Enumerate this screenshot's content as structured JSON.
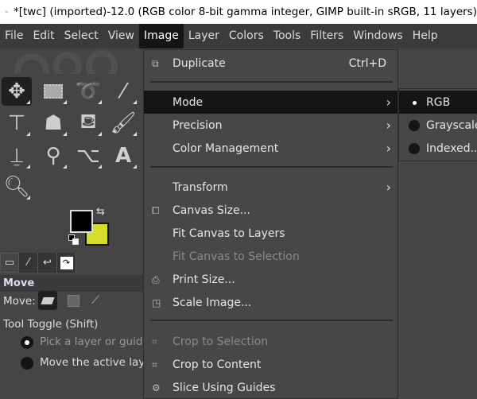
{
  "window": {
    "title": "*[twc] (imported)-12.0 (RGB color 8-bit gamma integer, GIMP built-in sRGB, 11 layers)"
  },
  "menubar": [
    "File",
    "Edit",
    "Select",
    "View",
    "Image",
    "Layer",
    "Colors",
    "Tools",
    "Filters",
    "Windows",
    "Help"
  ],
  "image_menu": {
    "duplicate": {
      "label": "Duplicate",
      "shortcut": "Ctrl+D"
    },
    "mode": "Mode",
    "precision": "Precision",
    "color_management": "Color Management",
    "transform": "Transform",
    "canvas_size": "Canvas Size...",
    "fit_canvas_layers": "Fit Canvas to Layers",
    "fit_canvas_selection": "Fit Canvas to Selection",
    "print_size": "Print Size...",
    "scale_image": "Scale Image...",
    "crop_selection": "Crop to Selection",
    "crop_content": "Crop to Content",
    "slice_guides": "Slice Using Guides"
  },
  "mode_submenu": {
    "rgb": "RGB",
    "grayscale": "Grayscale",
    "indexed": "Indexed..."
  },
  "colors": {
    "foreground": "#000000",
    "background": "#d6dc2c"
  },
  "tool_options": {
    "title": "Move",
    "move_label": "Move:",
    "toggle_label": "Tool Toggle  (Shift)",
    "opt1": "Pick a layer or guide",
    "opt2": "Move the active layer"
  }
}
